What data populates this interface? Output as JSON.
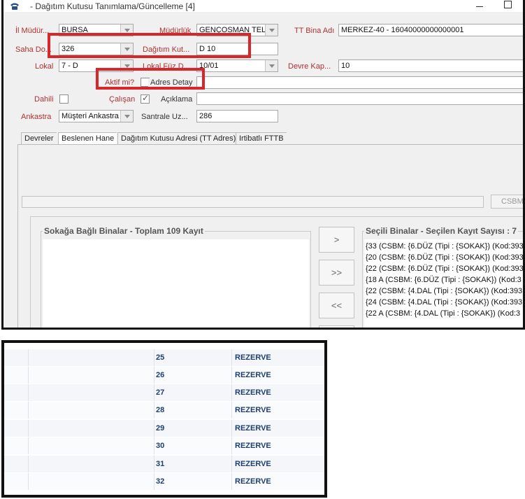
{
  "window": {
    "title": "- Dağıtım Kutusu Tanımlama/Güncelleme [4]"
  },
  "form": {
    "il_mudurlugu": {
      "label": "İl Müdür...",
      "value": "BURSA"
    },
    "mudurluk": {
      "label": "Müdürlük",
      "value": "GENÇOSMAN TELEKOM"
    },
    "tt_bina_adi": {
      "label": "TT Bina Adı",
      "value": "MERKEZ-40 - 16040000000000001"
    },
    "saha_dolabi": {
      "label": "Saha Do...",
      "value": "326"
    },
    "dagitim_kutusu": {
      "label": "Dağıtım Kut...",
      "value": "D 10"
    },
    "lokal": {
      "label": "Lokal",
      "value": "7 - D"
    },
    "lokal_fuz": {
      "label": "Lokal Füz D...",
      "value": "10/01"
    },
    "devre_kapasitesi": {
      "label": "Devre Kap...",
      "value": "10"
    },
    "aktif_mi": {
      "label": "Aktif mi?"
    },
    "adres_detay": {
      "label": "Adres Detay",
      "value": ""
    },
    "dahili": {
      "label": "Dahili"
    },
    "calisan": {
      "label": "Çalışan"
    },
    "aciklama": {
      "label": "Açıklama",
      "value": ""
    },
    "ankastra": {
      "label": "Ankastra",
      "value": "Müşteri Ankastra"
    },
    "santrale_uzaklik": {
      "label": "Santrale Uz...",
      "value": "286"
    }
  },
  "tabs": [
    "Devreler",
    "Beslenen Hane",
    "Dağıtım Kutusu Adresi (TT Adres)",
    "Irtibatlı FTTB"
  ],
  "csbm_button": "CSBM S",
  "left_group": {
    "title": "Sokağa Bağlı Binalar - Toplam 109 Kayıt"
  },
  "right_group": {
    "title": "Seçili Binalar - Seçilen Kayıt Sayısı : 7"
  },
  "move_buttons": [
    ">",
    ">>",
    "<<"
  ],
  "selected_buildings": [
    "{33  (CSBM: {6.DÜZ  (Tipi : {SOKAK}) (Kod:393",
    "{20  (CSBM: {6.DÜZ  (Tipi : {SOKAK}) (Kod:393",
    "{22  (CSBM: {6.DÜZ  (Tipi : {SOKAK}) (Kod:393",
    "{18 A  (CSBM: {6.DÜZ  (Tipi : {SOKAK}) (Kod:3",
    "{22  (CSBM: {4.DAL  (Tipi : {SOKAK}) (Kod:393",
    "{24  (CSBM: {4.DAL  (Tipi : {SOKAK}) (Kod:393",
    "{22 A  (CSBM: {4.DAL  (Tipi : {SOKAK}) (Kod:3"
  ],
  "table_rows": [
    {
      "no": "25",
      "status": "REZERVE"
    },
    {
      "no": "26",
      "status": "REZERVE"
    },
    {
      "no": "27",
      "status": "REZERVE"
    },
    {
      "no": "28",
      "status": "REZERVE"
    },
    {
      "no": "29",
      "status": "REZERVE"
    },
    {
      "no": "30",
      "status": "REZERVE"
    },
    {
      "no": "31",
      "status": "REZERVE"
    },
    {
      "no": "32",
      "status": "REZERVE"
    }
  ],
  "colors": {
    "label_red": "#b03030",
    "highlight": "#d9262a",
    "table_text": "#1c3f70"
  }
}
